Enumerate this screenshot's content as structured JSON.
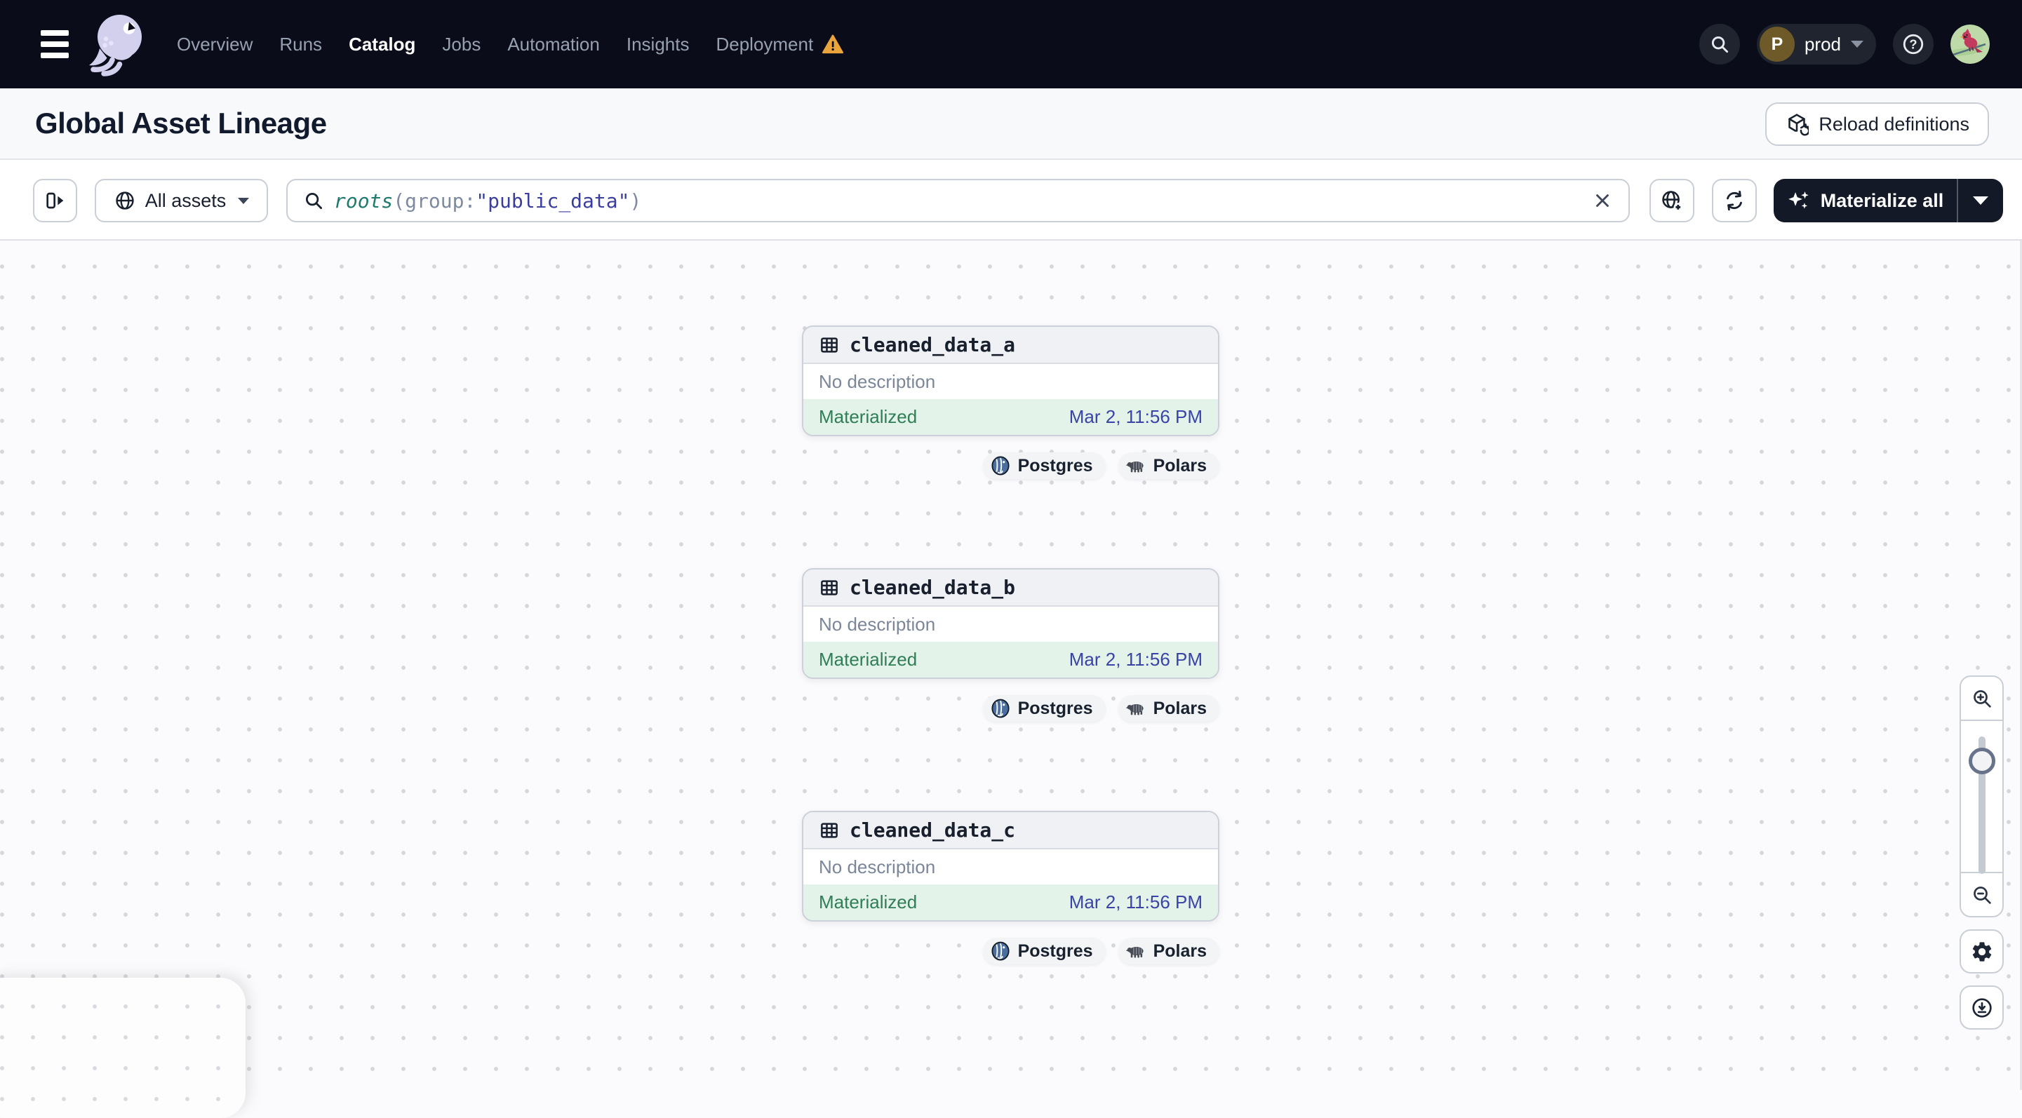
{
  "nav": {
    "items": [
      {
        "label": "Overview"
      },
      {
        "label": "Runs"
      },
      {
        "label": "Catalog",
        "active": true
      },
      {
        "label": "Jobs"
      },
      {
        "label": "Automation"
      },
      {
        "label": "Insights"
      },
      {
        "label": "Deployment",
        "warning": true
      }
    ],
    "environment": {
      "initial": "P",
      "name": "prod"
    }
  },
  "header": {
    "title": "Global Asset Lineage",
    "reload_label": "Reload definitions"
  },
  "toolbar": {
    "scope_label": "All assets",
    "materialize_label": "Materialize all",
    "query": {
      "function": "roots",
      "open_paren": "(",
      "field": "group:",
      "value": "\"public_data\"",
      "close_paren": ")"
    }
  },
  "graph": {
    "nodes": [
      {
        "name": "cleaned_data_a",
        "description": "No description",
        "status": "Materialized",
        "timestamp": "Mar 2, 11:56 PM",
        "tags": [
          "Postgres",
          "Polars"
        ]
      },
      {
        "name": "cleaned_data_b",
        "description": "No description",
        "status": "Materialized",
        "timestamp": "Mar 2, 11:56 PM",
        "tags": [
          "Postgres",
          "Polars"
        ]
      },
      {
        "name": "cleaned_data_c",
        "description": "No description",
        "status": "Materialized",
        "timestamp": "Mar 2, 11:56 PM",
        "tags": [
          "Postgres",
          "Polars"
        ]
      }
    ]
  },
  "icons": {
    "help_glyph": "?"
  },
  "colors": {
    "nav_bg": "#0a0d19",
    "accent_dark_button": "#141927",
    "status_green": "#2f7e56",
    "status_green_bg": "#e3f3e9",
    "timestamp_indigo": "#3a43a8",
    "warning_orange": "#eba43c",
    "query_teal": "#1f7a6e",
    "query_indigo": "#3a3f9f",
    "logo_lavender": "#d3d0ee"
  }
}
